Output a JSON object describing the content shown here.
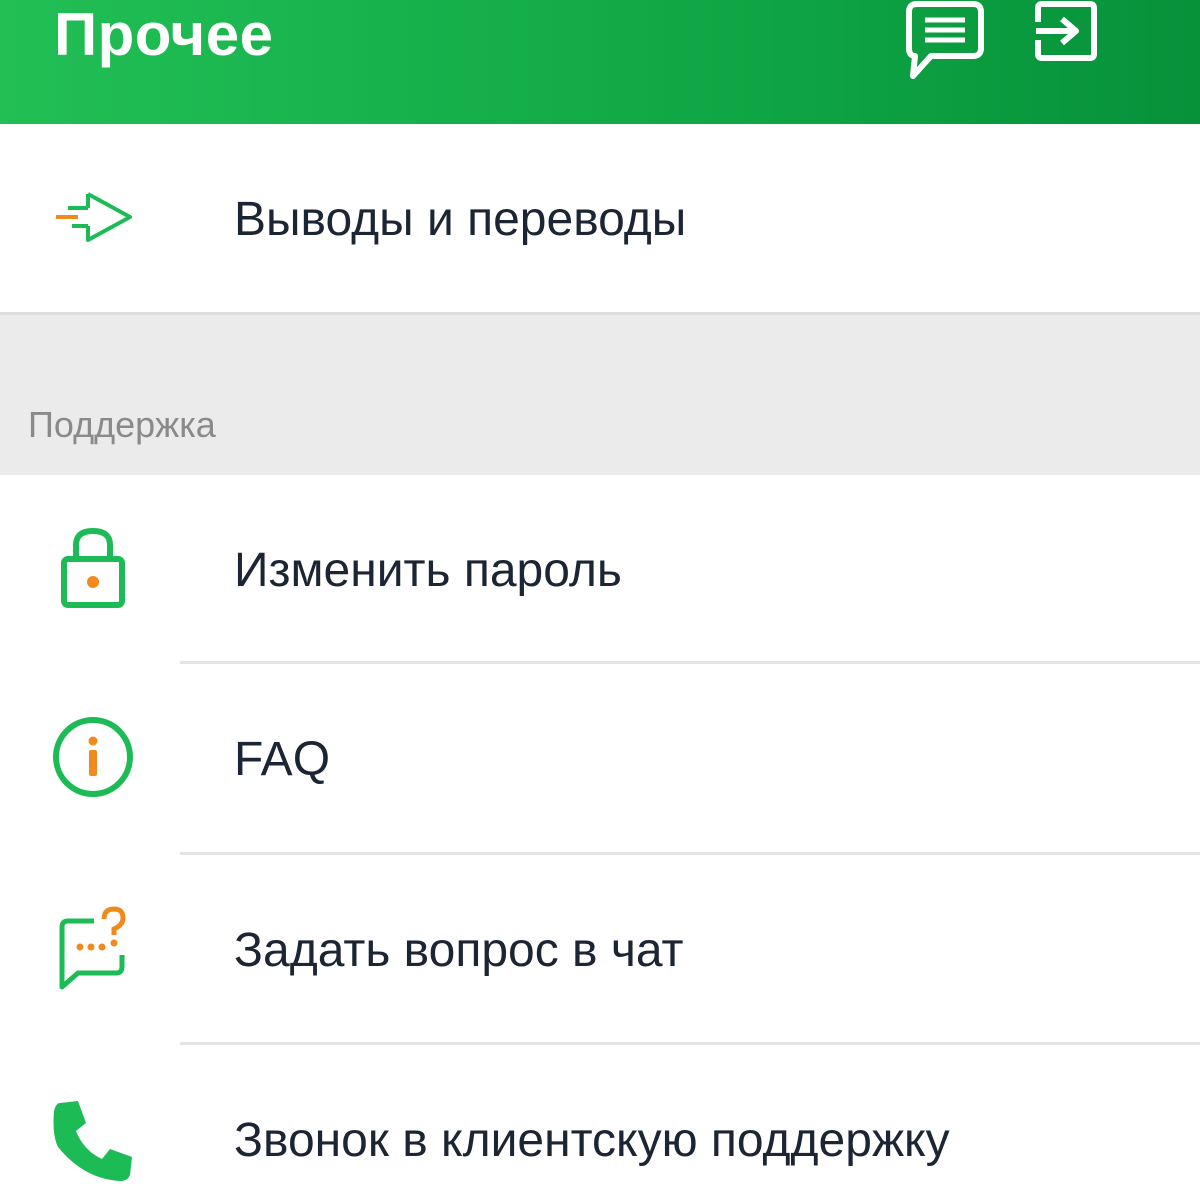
{
  "header": {
    "title": "Прочее",
    "actions": [
      {
        "name": "chat",
        "icon": "chat-icon"
      },
      {
        "name": "logout",
        "icon": "logout-icon"
      }
    ]
  },
  "top_item": {
    "label": "Выводы и переводы",
    "icon": "transfer-arrow-icon"
  },
  "section": {
    "title": "Поддержка"
  },
  "support_items": [
    {
      "label": "Изменить пароль",
      "icon": "lock-icon"
    },
    {
      "label": "FAQ",
      "icon": "info-icon"
    },
    {
      "label": "Задать вопрос в чат",
      "icon": "chat-question-icon"
    },
    {
      "label": "Звонок в клиентскую поддержку",
      "icon": "phone-icon"
    }
  ],
  "colors": {
    "brand_green": "#1dbb55",
    "accent_orange": "#f08a1c",
    "text": "#1c2533",
    "section_bg": "#ebebeb",
    "section_text": "#8a8a8a"
  }
}
